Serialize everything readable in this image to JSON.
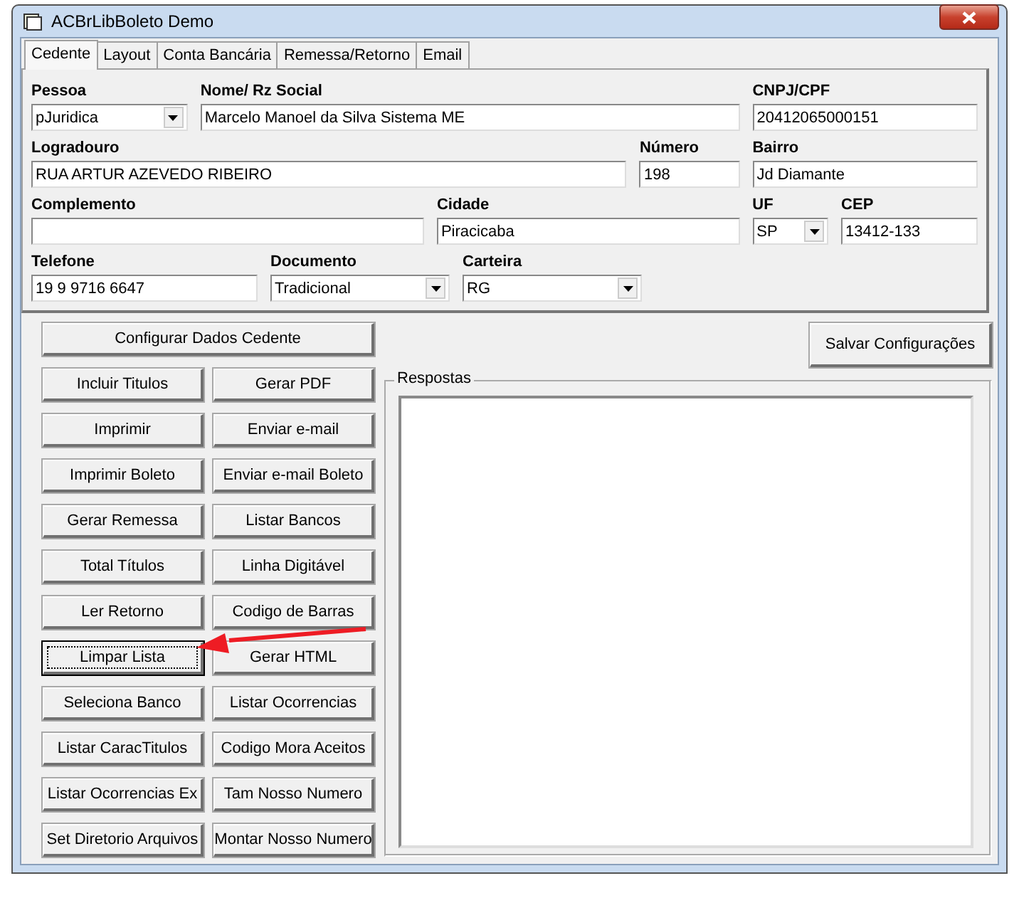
{
  "window": {
    "title": "ACBrLibBoleto Demo"
  },
  "tabs": [
    {
      "label": "Cedente",
      "selected": true
    },
    {
      "label": "Layout",
      "selected": false
    },
    {
      "label": "Conta Bancária",
      "selected": false
    },
    {
      "label": "Remessa/Retorno",
      "selected": false
    },
    {
      "label": "Email",
      "selected": false
    }
  ],
  "form_rows": [
    [
      {
        "label": "Pessoa",
        "kind": "select",
        "value": "pJuridica"
      },
      {
        "label": "Nome/ Rz Social",
        "kind": "text",
        "value": "Marcelo Manoel da Silva Sistema ME"
      },
      {
        "label": "CNPJ/CPF",
        "kind": "text",
        "value": "20412065000151"
      }
    ],
    [
      {
        "label": "Logradouro",
        "kind": "text",
        "value": "RUA ARTUR AZEVEDO RIBEIRO"
      },
      {
        "label": "Número",
        "kind": "text",
        "value": "198"
      },
      {
        "label": "Bairro",
        "kind": "text",
        "value": "Jd Diamante"
      }
    ],
    [
      {
        "label": "Complemento",
        "kind": "text"
      },
      {
        "label": "Cidade",
        "kind": "text",
        "value": "Piracicaba"
      },
      {
        "label": "UF",
        "kind": "select",
        "value": "SP"
      },
      {
        "label": "CEP",
        "kind": "text",
        "value": "13412-133"
      }
    ],
    [
      {
        "label": "Telefone",
        "kind": "text",
        "value": "19 9 9716 6647"
      },
      {
        "label": "Documento",
        "kind": "select",
        "value": "Tradicional"
      },
      {
        "label": "Carteira",
        "kind": "select",
        "value": "RG"
      }
    ]
  ],
  "config_button": "Configurar Dados Cedente",
  "save_button": "Salvar Configurações",
  "buttons": [
    {
      "label": "Incluir Titulos",
      "focused": false
    },
    {
      "label": "Gerar PDF",
      "focused": false
    },
    {
      "label": "Imprimir",
      "focused": false
    },
    {
      "label": "Enviar e-mail",
      "focused": false
    },
    {
      "label": "Imprimir Boleto",
      "focused": false
    },
    {
      "label": "Enviar e-mail Boleto",
      "focused": false
    },
    {
      "label": "Gerar Remessa",
      "focused": false
    },
    {
      "label": "Listar Bancos",
      "focused": false
    },
    {
      "label": "Total Títulos",
      "focused": false
    },
    {
      "label": "Linha Digitável",
      "focused": false
    },
    {
      "label": "Ler Retorno",
      "focused": false
    },
    {
      "label": "Codigo de Barras",
      "focused": false
    },
    {
      "label": "Limpar Lista",
      "focused": true
    },
    {
      "label": "Gerar HTML",
      "focused": false
    },
    {
      "label": "Seleciona Banco",
      "focused": false
    },
    {
      "label": "Listar Ocorrencias",
      "focused": false
    },
    {
      "label": "Listar CaracTitulos",
      "focused": false
    },
    {
      "label": "Codigo Mora Aceitos",
      "focused": false
    },
    {
      "label": "Listar Ocorrencias Ex",
      "focused": false
    },
    {
      "label": "Tam Nosso Numero",
      "focused": false
    },
    {
      "label": "Set Diretorio Arquivos",
      "focused": false
    },
    {
      "label": "Montar Nosso Numero",
      "focused": false
    }
  ],
  "responses": {
    "label": "Respostas"
  }
}
